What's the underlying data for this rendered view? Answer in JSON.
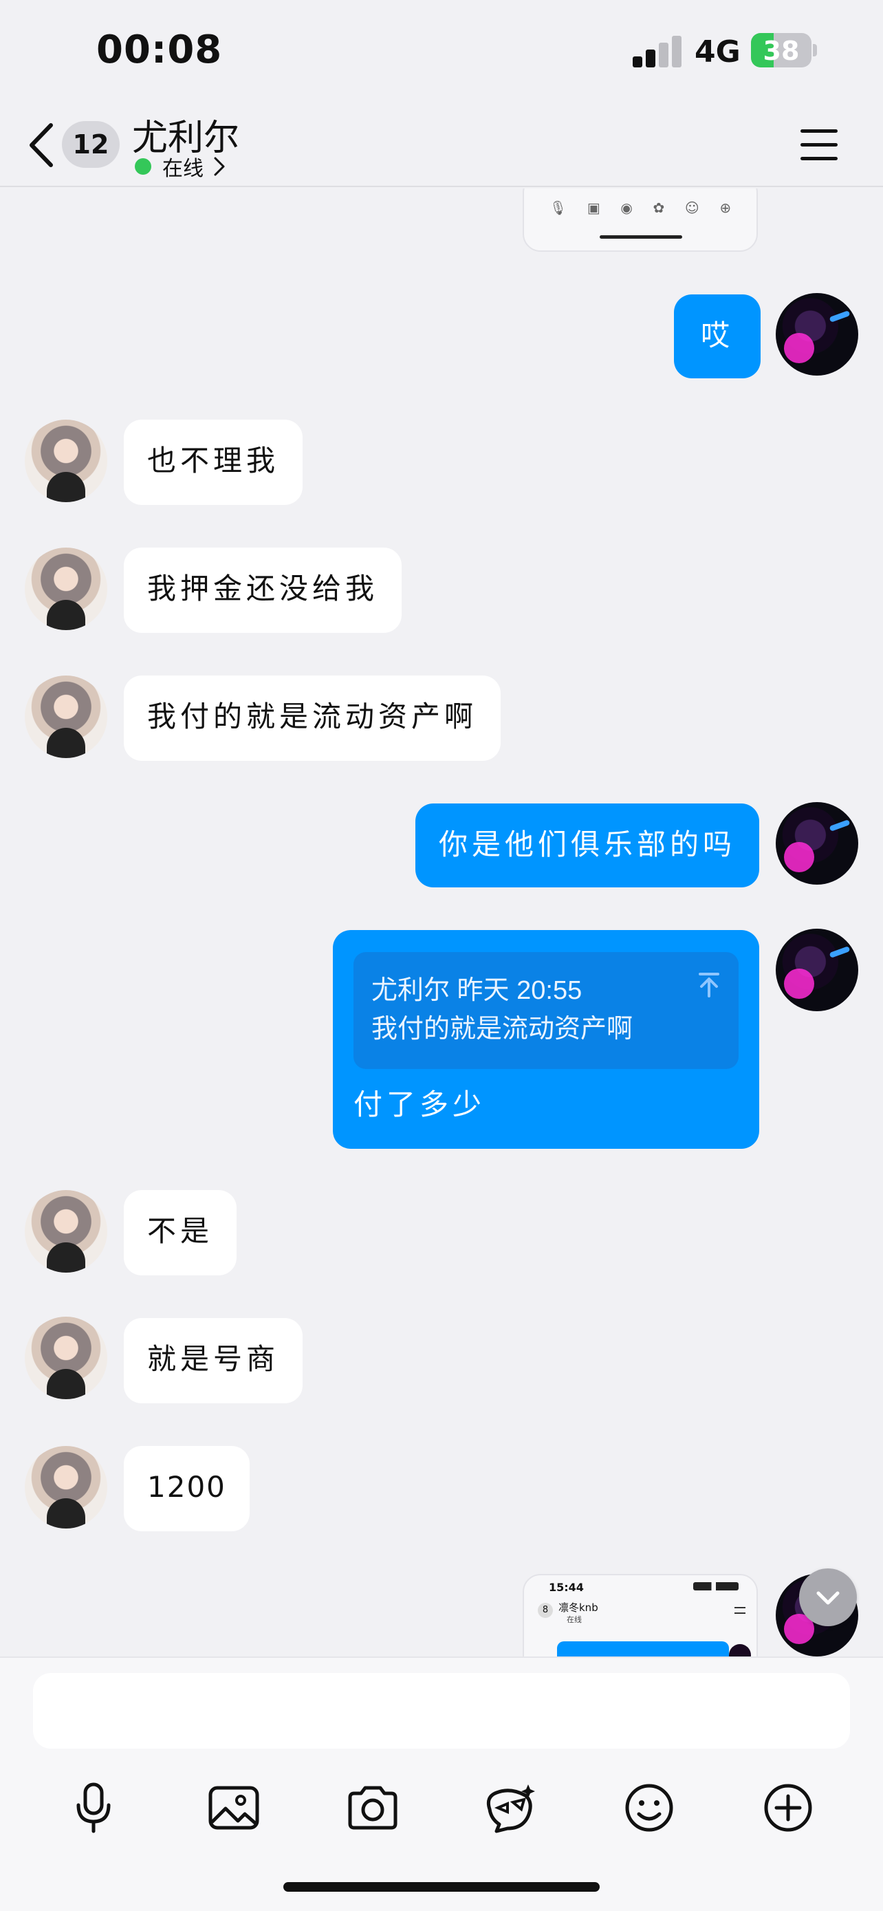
{
  "status_bar": {
    "time": "00:08",
    "network": "4G",
    "battery": "38",
    "battery_level": 0.38,
    "signal_bars_filled": 2
  },
  "nav": {
    "unread_count": "12",
    "contact_name": "尤利尔",
    "presence": "在线",
    "icons": [
      "back-chevron-icon",
      "menu-icon",
      "chevron-right-icon"
    ]
  },
  "messages": [
    {
      "side": "out",
      "kind": "screenshot",
      "caption": ""
    },
    {
      "side": "out",
      "kind": "text",
      "text": "哎"
    },
    {
      "side": "in",
      "kind": "text",
      "text": "也不理我"
    },
    {
      "side": "in",
      "kind": "text",
      "text": "我押金还没给我"
    },
    {
      "side": "in",
      "kind": "text",
      "text": "我付的就是流动资产啊"
    },
    {
      "side": "out",
      "kind": "text",
      "text": "你是他们俱乐部的吗"
    },
    {
      "side": "out",
      "kind": "reply",
      "quote_meta": "尤利尔 昨天 20:55",
      "quote_text": "我付的就是流动资产啊",
      "text": "付了多少"
    },
    {
      "side": "in",
      "kind": "text",
      "text": "不是"
    },
    {
      "side": "in",
      "kind": "text",
      "text": "就是号商"
    },
    {
      "side": "in",
      "kind": "text",
      "text": "1200"
    },
    {
      "side": "out",
      "kind": "screenshot",
      "mini_time": "15:44",
      "mini_name": "凛冬knb",
      "mini_presence": "在线",
      "mini_badge": "8"
    }
  ],
  "input": {
    "placeholder": ""
  },
  "toolbar": [
    "microphone-icon",
    "image-icon",
    "camera-icon",
    "sticker-icon",
    "emoji-icon",
    "plus-icon"
  ],
  "colors": {
    "outgoing_bubble": "#0095ff",
    "incoming_bubble": "#ffffff",
    "background": "#f1f1f4",
    "online": "#34c759"
  }
}
